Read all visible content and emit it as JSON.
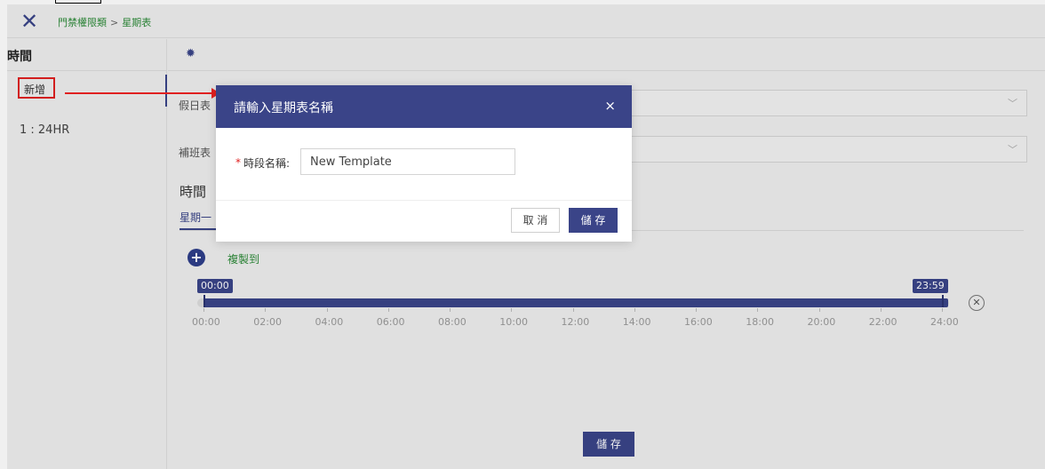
{
  "breadcrumb": {
    "parent": "門禁權限類",
    "separator": ">",
    "current": "星期表"
  },
  "sidebar": {
    "title": "時間",
    "items": [
      {
        "label": "新增"
      },
      {
        "label": "1 : 24HR"
      }
    ]
  },
  "form": {
    "holiday_label": "假日表",
    "makeup_label": "補班表",
    "section_title": "時間",
    "tab": "星期一",
    "copy_link": "複製到"
  },
  "timeline": {
    "start": "00:00",
    "end": "23:59",
    "ticks": [
      "00:00",
      "02:00",
      "04:00",
      "06:00",
      "08:00",
      "10:00",
      "12:00",
      "14:00",
      "16:00",
      "18:00",
      "20:00",
      "22:00",
      "24:00"
    ]
  },
  "footer": {
    "save": "儲 存"
  },
  "modal": {
    "title": "請輸入星期表名稱",
    "close": "×",
    "field_label": "時段名稱:",
    "field_value": "New Template",
    "cancel": "取 消",
    "save": "儲 存"
  },
  "colors": {
    "primary": "#3a4488",
    "link": "#2e8b3a",
    "annotation": "#e02020"
  }
}
